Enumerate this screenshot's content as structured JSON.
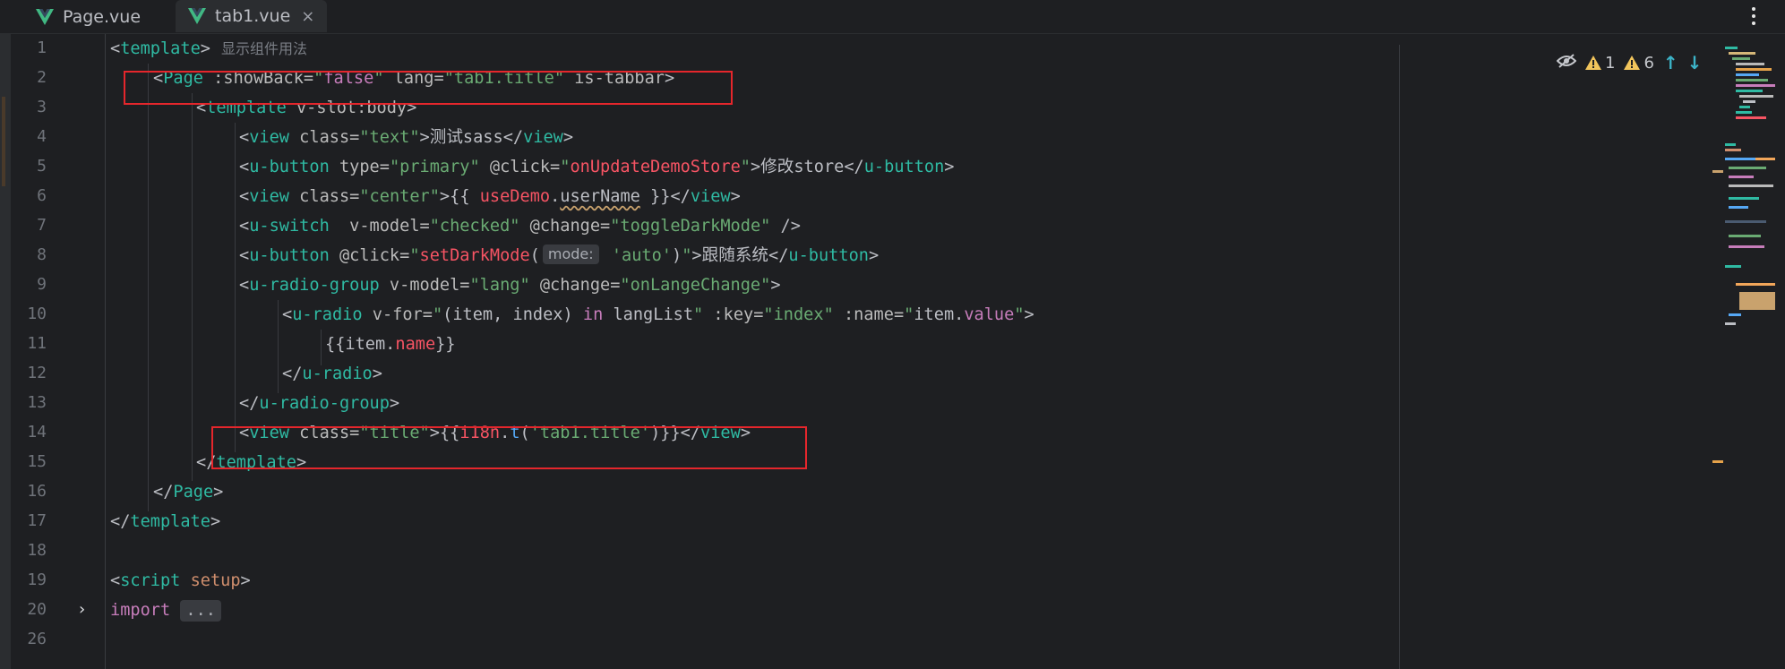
{
  "tabs": [
    {
      "label": "Page.vue",
      "active": false
    },
    {
      "label": "tab1.vue",
      "active": true,
      "close": "×"
    }
  ],
  "line_numbers": [
    "1",
    "2",
    "3",
    "4",
    "5",
    "6",
    "7",
    "8",
    "9",
    "10",
    "11",
    "12",
    "13",
    "14",
    "15",
    "16",
    "17",
    "18",
    "19",
    "20",
    "26"
  ],
  "code": {
    "l1": {
      "open": "<",
      "name": "template",
      "close": ">",
      "comment": "显示组件用法"
    },
    "l2": {
      "lt": "<",
      "name": "Page",
      "a1": " :showBack=",
      "v1": "\"",
      "v1b": "false",
      "v1c": "\"",
      "a2": " lang=",
      "v2": "\"tab1.title\"",
      "a3": " is-tabbar",
      "gt": ">"
    },
    "l3": {
      "lt": "<",
      "name": "template",
      "a1": " v-slot:body",
      "gt": ">"
    },
    "l4": {
      "lt": "<",
      "name": "view",
      "a1": " class=",
      "v1": "\"text\"",
      "gt": ">",
      "text": "测试sass",
      "clt": "</",
      "cname": "view",
      "cgt": ">"
    },
    "l5": {
      "lt": "<",
      "name": "u-button",
      "a1": " type=",
      "v1": "\"primary\"",
      "a2": " @click=",
      "q1": "\"",
      "fn": "onUpdateDemoStore",
      "q2": "\"",
      "gt": ">",
      "text": "修改store",
      "clt": "</",
      "cname": "u-button",
      "cgt": ">"
    },
    "l6": {
      "lt": "<",
      "name": "view",
      "a1": " class=",
      "v1": "\"center\"",
      "gt": ">",
      "mo": "{{ ",
      "obj": "useDemo",
      "dot": ".",
      "prop": "userName",
      "mc": " }}",
      "clt": "</",
      "cname": "view",
      "cgt": ">"
    },
    "l7": {
      "lt": "<",
      "name": "u-switch",
      "a1": "  v-model=",
      "v1": "\"checked\"",
      "a2": " @change=",
      "v2": "\"toggleDarkMode\"",
      "end": " />"
    },
    "l8": {
      "lt": "<",
      "name": "u-button",
      "a1": " @click=",
      "q1": "\"",
      "fn": "setDarkMode",
      "po": "(",
      "hint": "mode:",
      "arg": " 'auto'",
      "pc": ")",
      "q2": "\"",
      "gt": ">",
      "text": "跟随系统",
      "clt": "</",
      "cname": "u-button",
      "cgt": ">"
    },
    "l9": {
      "lt": "<",
      "name": "u-radio-group",
      "a1": " v-model=",
      "v1": "\"lang\"",
      "a2": " @change=",
      "v2": "\"onLangeChange\"",
      "gt": ">"
    },
    "l10": {
      "lt": "<",
      "name": "u-radio",
      "a1": " v-for=",
      "q1": "\"",
      "p1": "(item, index) ",
      "kwin": "in",
      "p2": " langList",
      "q2": "\"",
      "a2": " :key=",
      "v2": "\"index\"",
      "a3": " :name=",
      "q3": "\"",
      "p3": "item.",
      "field": "value",
      "q4": "\"",
      "gt": ">"
    },
    "l11": {
      "mo": "{{",
      "obj": "item",
      "dot": ".",
      "prop": "name",
      "mc": "}}"
    },
    "l12": {
      "lt": "</",
      "name": "u-radio",
      "gt": ">"
    },
    "l13": {
      "lt": "</",
      "name": "u-radio-group",
      "gt": ">"
    },
    "l14": {
      "lt": "<",
      "name": "view",
      "a1": " class=",
      "v1": "\"title\"",
      "gt": ">",
      "mo": "{{",
      "obj": "i18n",
      "dot": ".",
      "fn": "t",
      "po": "(",
      "arg": "'tab1.title'",
      "pc": ")",
      "mc": "}}",
      "clt": "</",
      "cname": "view",
      "cgt": ">"
    },
    "l15": {
      "lt": "</",
      "name": "template",
      "gt": ">"
    },
    "l16": {
      "lt": "</",
      "name": "Page",
      "gt": ">"
    },
    "l17": {
      "lt": "</",
      "name": "template",
      "gt": ">"
    },
    "l19": {
      "lt": "<",
      "name": "script",
      "a1": " setup",
      "gt": ">"
    },
    "l20": {
      "kw": "import",
      "fold": "..."
    }
  },
  "inspections": {
    "errors": "1",
    "warnings": "6"
  },
  "colors": {
    "highlight_box": "#e5262c",
    "bg": "#1e1f22"
  }
}
